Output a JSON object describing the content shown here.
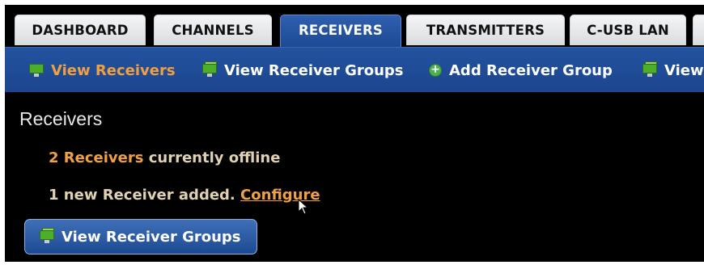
{
  "tabs": [
    {
      "label": "DASHBOARD",
      "active": false
    },
    {
      "label": "CHANNELS",
      "active": false
    },
    {
      "label": "RECEIVERS",
      "active": true
    },
    {
      "label": "TRANSMITTERS",
      "active": false
    },
    {
      "label": "C-USB LAN",
      "active": false
    }
  ],
  "subnav": {
    "items": [
      {
        "label": "View Receivers",
        "icon": "monitor-icon",
        "active": true
      },
      {
        "label": "View Receiver Groups",
        "icon": "monitor-group-icon",
        "active": false
      },
      {
        "label": "Add Receiver Group",
        "icon": "plus-circle-icon",
        "active": false
      },
      {
        "label": "View",
        "icon": "monitor-group-icon",
        "active": false
      }
    ]
  },
  "main": {
    "heading": "Receivers",
    "offline_count": "2 Receivers",
    "offline_text": "currently offline",
    "new_text": "1 new Receiver added.",
    "configure_link": "Configure",
    "view_groups_button": "View Receiver Groups"
  },
  "colors": {
    "accent_orange": "#f0a040",
    "nav_blue": "#1d4a95",
    "background": "#000000"
  }
}
